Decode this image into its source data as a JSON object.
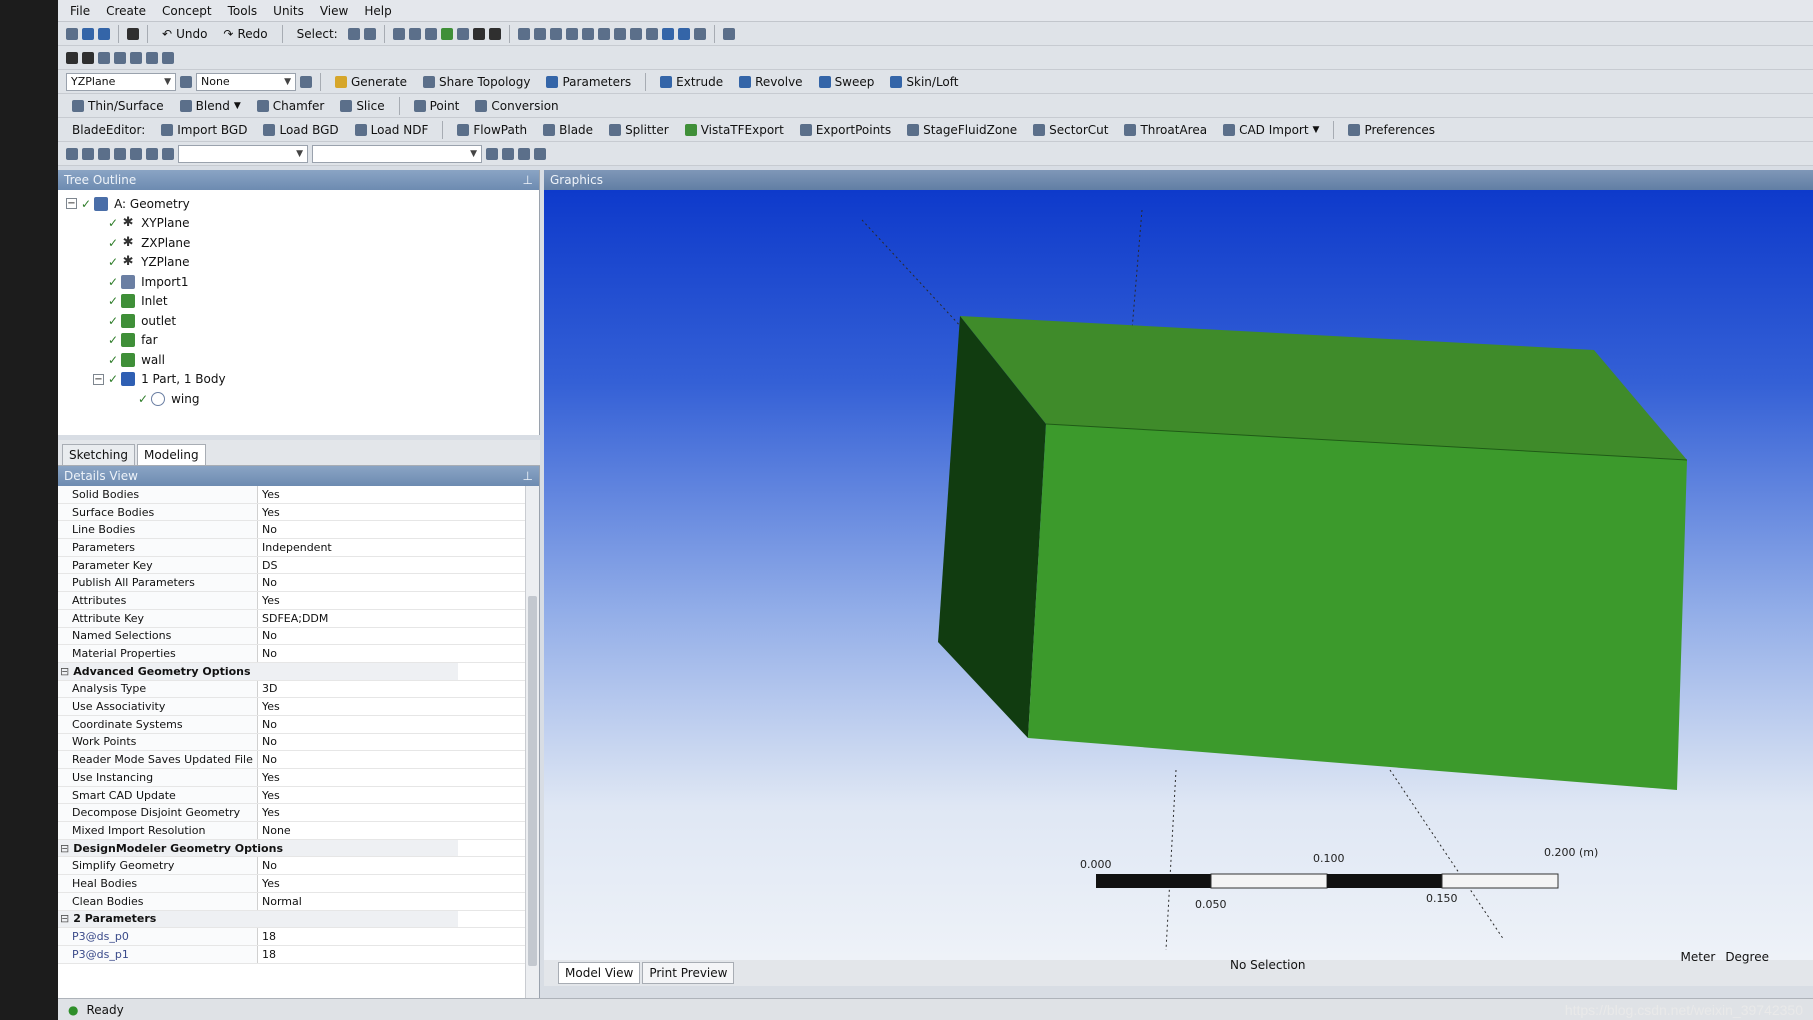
{
  "menu": [
    "File",
    "Create",
    "Concept",
    "Tools",
    "Units",
    "View",
    "Help"
  ],
  "toolbar1": {
    "undo": "Undo",
    "redo": "Redo",
    "select": "Select:"
  },
  "toolbar3": {
    "plane_combo": "YZPlane",
    "sketch_combo": "None",
    "generate": "Generate",
    "share_topology": "Share Topology",
    "parameters": "Parameters",
    "extrude": "Extrude",
    "revolve": "Revolve",
    "sweep": "Sweep",
    "skin_loft": "Skin/Loft"
  },
  "toolbar4": {
    "thin_surface": "Thin/Surface",
    "blend": "Blend",
    "chamfer": "Chamfer",
    "slice": "Slice",
    "point": "Point",
    "conversion": "Conversion"
  },
  "toolbar5": {
    "blade_editor": "BladeEditor:",
    "import_bgd": "Import BGD",
    "load_bgd": "Load BGD",
    "load_ndf": "Load NDF",
    "flowpath": "FlowPath",
    "blade": "Blade",
    "splitter": "Splitter",
    "vistatfexport": "VistaTFExport",
    "exportpoints": "ExportPoints",
    "stagefluidzone": "StageFluidZone",
    "sectorcut": "SectorCut",
    "throatarea": "ThroatArea",
    "cad_import": "CAD Import",
    "preferences": "Preferences"
  },
  "tree": {
    "title": "Tree Outline",
    "items": [
      {
        "label": "A: Geometry"
      },
      {
        "label": "XYPlane"
      },
      {
        "label": "ZXPlane"
      },
      {
        "label": "YZPlane"
      },
      {
        "label": "Import1"
      },
      {
        "label": "Inlet"
      },
      {
        "label": "outlet"
      },
      {
        "label": "far"
      },
      {
        "label": "wall"
      },
      {
        "label": "1 Part, 1 Body"
      },
      {
        "label": "wing"
      }
    ]
  },
  "tabs": {
    "sketching": "Sketching",
    "modeling": "Modeling"
  },
  "details": {
    "title": "Details View",
    "rows": [
      {
        "k": "Solid Bodies",
        "v": "Yes"
      },
      {
        "k": "Surface Bodies",
        "v": "Yes"
      },
      {
        "k": "Line Bodies",
        "v": "No"
      },
      {
        "k": "Parameters",
        "v": "Independent"
      },
      {
        "k": "Parameter Key",
        "v": "DS"
      },
      {
        "k": "Publish All Parameters",
        "v": "No"
      },
      {
        "k": "Attributes",
        "v": "Yes"
      },
      {
        "k": "Attribute Key",
        "v": "SDFEA;DDM"
      },
      {
        "k": "Named Selections",
        "v": "No"
      },
      {
        "k": "Material Properties",
        "v": "No"
      },
      {
        "k": "Advanced Geometry Options",
        "v": ""
      },
      {
        "k": "Analysis Type",
        "v": "3D"
      },
      {
        "k": "Use Associativity",
        "v": "Yes"
      },
      {
        "k": "Coordinate Systems",
        "v": "No"
      },
      {
        "k": "Work Points",
        "v": "No"
      },
      {
        "k": "Reader Mode Saves Updated File",
        "v": "No"
      },
      {
        "k": "Use Instancing",
        "v": "Yes"
      },
      {
        "k": "Smart CAD Update",
        "v": "Yes"
      },
      {
        "k": "Decompose Disjoint Geometry",
        "v": "Yes"
      },
      {
        "k": "Mixed Import Resolution",
        "v": "None"
      },
      {
        "k": "DesignModeler Geometry Options",
        "v": ""
      },
      {
        "k": "Simplify Geometry",
        "v": "No"
      },
      {
        "k": "Heal Bodies",
        "v": "Yes"
      },
      {
        "k": "Clean Bodies",
        "v": "Normal"
      },
      {
        "k": "2 Parameters",
        "v": ""
      },
      {
        "k": "P3@ds_p0",
        "v": "18"
      },
      {
        "k": "P3@ds_p1",
        "v": "18"
      }
    ]
  },
  "graphics": {
    "title": "Graphics",
    "scale": {
      "top_labels": [
        "0.000",
        "0.100",
        "0.200 (m)"
      ],
      "bottom_labels": [
        "0.050",
        "0.150"
      ]
    }
  },
  "view_tabs": {
    "model_view": "Model View",
    "print_preview": "Print Preview"
  },
  "status": {
    "selection": "No Selection",
    "length_unit": "Meter",
    "angle_unit": "Degree",
    "ready": "Ready"
  },
  "watermark": "https://blog.csdn.net/weixin_39742350",
  "colors": {
    "box_top": "#3f8b2a",
    "box_front": "#3c9a2c",
    "box_side": "#113c10",
    "background_top": "#0e3acb",
    "background_bottom": "#eef2f8"
  }
}
